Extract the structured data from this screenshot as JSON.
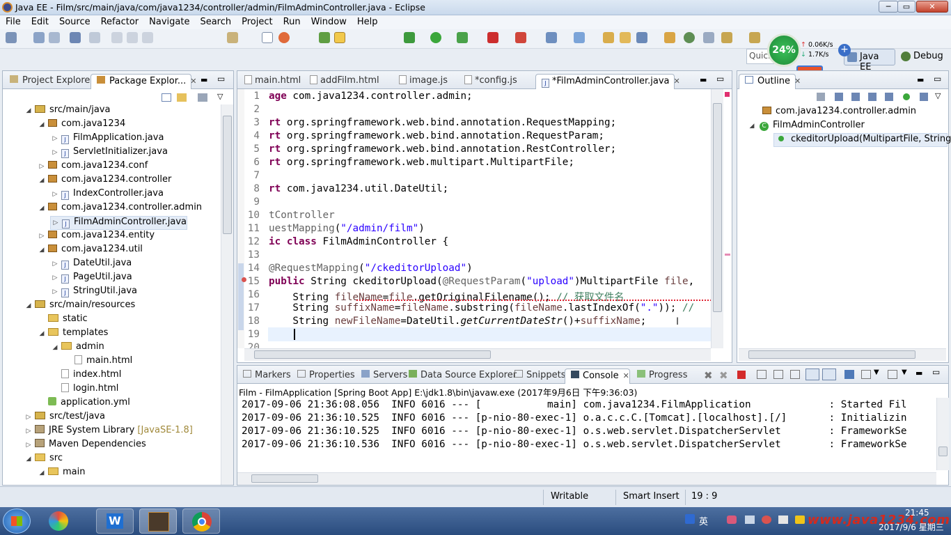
{
  "window": {
    "title": "Java EE - Film/src/main/java/com/java1234/controller/admin/FilmAdminController.java - Eclipse"
  },
  "menu": [
    "File",
    "Edit",
    "Source",
    "Refactor",
    "Navigate",
    "Search",
    "Project",
    "Run",
    "Window",
    "Help"
  ],
  "quick_access": "Quick",
  "perspectives": {
    "java_ee": "Java EE",
    "debug": "Debug"
  },
  "overlay": {
    "cpu": "24%",
    "upload": "0.06K/s",
    "download": "1.7K/s",
    "ime": "英"
  },
  "left_panel": {
    "tabs": [
      "Project Explorer",
      "Package Explor..."
    ],
    "tree": [
      {
        "indent": 2,
        "tw": "◢",
        "icon": "src",
        "label": "src/main/java"
      },
      {
        "indent": 3,
        "tw": "◢",
        "icon": "pkg",
        "label": "com.java1234"
      },
      {
        "indent": 4,
        "tw": "▷",
        "icon": "java",
        "label": "FilmApplication.java"
      },
      {
        "indent": 4,
        "tw": "▷",
        "icon": "java",
        "label": "ServletInitializer.java"
      },
      {
        "indent": 3,
        "tw": "▷",
        "icon": "pkg",
        "label": "com.java1234.conf"
      },
      {
        "indent": 3,
        "tw": "◢",
        "icon": "pkg",
        "label": "com.java1234.controller"
      },
      {
        "indent": 4,
        "tw": "▷",
        "icon": "java",
        "label": "IndexController.java"
      },
      {
        "indent": 3,
        "tw": "◢",
        "icon": "pkg",
        "label": "com.java1234.controller.admin"
      },
      {
        "indent": 4,
        "tw": "▷",
        "icon": "java",
        "label": "FilmAdminController.java",
        "selected": true
      },
      {
        "indent": 3,
        "tw": "▷",
        "icon": "pkg",
        "label": "com.java1234.entity"
      },
      {
        "indent": 3,
        "tw": "◢",
        "icon": "pkg",
        "label": "com.java1234.util"
      },
      {
        "indent": 4,
        "tw": "▷",
        "icon": "java",
        "label": "DateUtil.java"
      },
      {
        "indent": 4,
        "tw": "▷",
        "icon": "java",
        "label": "PageUtil.java"
      },
      {
        "indent": 4,
        "tw": "▷",
        "icon": "java",
        "label": "StringUtil.java"
      },
      {
        "indent": 2,
        "tw": "◢",
        "icon": "src",
        "label": "src/main/resources"
      },
      {
        "indent": 3,
        "tw": "",
        "icon": "fold",
        "label": "static"
      },
      {
        "indent": 3,
        "tw": "◢",
        "icon": "fold",
        "label": "templates"
      },
      {
        "indent": 4,
        "tw": "◢",
        "icon": "fold",
        "label": "admin"
      },
      {
        "indent": 5,
        "tw": "",
        "icon": "html",
        "label": "main.html"
      },
      {
        "indent": 4,
        "tw": "",
        "icon": "html",
        "label": "index.html"
      },
      {
        "indent": 4,
        "tw": "",
        "icon": "html",
        "label": "login.html"
      },
      {
        "indent": 3,
        "tw": "",
        "icon": "yml",
        "label": "application.yml"
      },
      {
        "indent": 2,
        "tw": "▷",
        "icon": "src",
        "label": "src/test/java"
      },
      {
        "indent": 2,
        "tw": "▷",
        "icon": "lib",
        "label": "JRE System Library",
        "suffix": "[JavaSE-1.8]"
      },
      {
        "indent": 2,
        "tw": "▷",
        "icon": "lib",
        "label": "Maven Dependencies"
      },
      {
        "indent": 2,
        "tw": "◢",
        "icon": "fold",
        "label": "src"
      },
      {
        "indent": 3,
        "tw": "◢",
        "icon": "fold",
        "label": "main"
      }
    ]
  },
  "editor": {
    "tabs": [
      "main.html",
      "addFilm.html",
      "image.js",
      "*config.js",
      "*FilmAdminController.java"
    ],
    "lines": [
      {
        "n": "1",
        "html": "<span class=\"kw\">age</span> com.java1234.controller.admin;"
      },
      {
        "n": "2",
        "html": ""
      },
      {
        "n": "3",
        "html": "<span class=\"kw\">rt</span> org.springframework.web.bind.annotation.RequestMapping;"
      },
      {
        "n": "4",
        "html": "<span class=\"kw\">rt</span> org.springframework.web.bind.annotation.RequestParam;"
      },
      {
        "n": "5",
        "html": "<span class=\"kw\">rt</span> org.springframework.web.bind.annotation.RestController;"
      },
      {
        "n": "6",
        "html": "<span class=\"kw\">rt</span> org.springframework.web.multipart.MultipartFile;"
      },
      {
        "n": "7",
        "html": ""
      },
      {
        "n": "8",
        "html": "<span class=\"kw\">rt</span> com.java1234.util.DateUtil;"
      },
      {
        "n": "9",
        "html": ""
      },
      {
        "n": "10",
        "html": "<span class=\"ann\">tController</span>"
      },
      {
        "n": "11",
        "html": "<span class=\"ann\">uestMapping</span>(<span class=\"str\">\"/admin/film\"</span>)"
      },
      {
        "n": "12",
        "html": "<span class=\"kw\">ic class</span> FilmAdminController {"
      },
      {
        "n": "13",
        "html": ""
      },
      {
        "n": "14",
        "html": "<span class=\"ann\">@RequestMapping</span>(<span class=\"str\">\"/ckeditorUpload\"</span>)"
      },
      {
        "n": "15",
        "html": "<span class=\"kw\">public</span> String ckeditorUpload(<span class=\"ann\">@RequestParam</span>(<span class=\"str\">\"upload\"</span>)MultipartFile <span class=\"fld\">file</span>,"
      },
      {
        "n": "16",
        "html": "    String <span class=\"fld\">fileName</span>=<span class=\"fld\">file</span>.getOriginalFilename(); <span class=\"cmt\">// 获取文件名</span>"
      },
      {
        "n": "17",
        "html": "    String <span class=\"fld\">suffixName</span>=<span class=\"fld\">fileName</span>.substring(<span class=\"fld\">fileName</span>.lastIndexOf(<span class=\"str\">\".\"</span>)); <span class=\"cmt\">//</span>"
      },
      {
        "n": "18",
        "html": "    String <span class=\"fld\">newFileName</span>=DateUtil.<span class=\"ital\">getCurrentDateStr</span>()+<span class=\"fld\">suffixName</span>;"
      },
      {
        "n": "19",
        "html": "    "
      },
      {
        "n": "20",
        "html": ""
      }
    ]
  },
  "outline": {
    "tab": "Outline",
    "items": [
      {
        "label": "com.java1234.controller.admin"
      },
      {
        "label": "FilmAdminController"
      },
      {
        "label": "ckeditorUpload(MultipartFile, String) :"
      }
    ]
  },
  "bottom": {
    "tabs": [
      "Markers",
      "Properties",
      "Servers",
      "Data Source Explorer",
      "Snippets",
      "Console",
      "Progress"
    ],
    "launch": "Film - FilmApplication [Spring Boot App] E:\\jdk1.8\\bin\\javaw.exe (2017年9月6日 下午9:36:03)",
    "console": [
      "2017-09-06 21:36:08.056  INFO 6016 --- [           main] com.java1234.FilmApplication             : Started Fil",
      "2017-09-06 21:36:10.525  INFO 6016 --- [p-nio-80-exec-1] o.a.c.c.C.[Tomcat].[localhost].[/]       : Initializin",
      "2017-09-06 21:36:10.525  INFO 6016 --- [p-nio-80-exec-1] o.s.web.servlet.DispatcherServlet        : FrameworkSe",
      "2017-09-06 21:36:10.536  INFO 6016 --- [p-nio-80-exec-1] o.s.web.servlet.DispatcherServlet        : FrameworkSe"
    ]
  },
  "status": {
    "writable": "Writable",
    "insert": "Smart Insert",
    "position": "19 : 9"
  },
  "taskbar": {
    "time": "21:45",
    "date": "2017/9/6 星期三",
    "ime": "英",
    "watermark": "www.java1234.com"
  }
}
